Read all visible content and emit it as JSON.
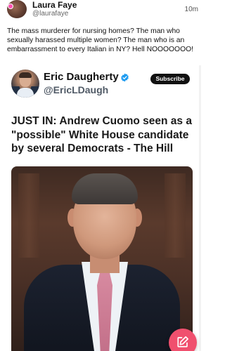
{
  "post": {
    "author_name": "Laura Faye",
    "author_handle": "@laurafaye",
    "timestamp": "10m",
    "text": "The mass murderer for nursing homes? The man who sexually harassed multiple women? The man who is an embarrassment to every Italian in NY? Hell NOOOOOOO!"
  },
  "embed": {
    "author_name": "Eric Daugherty",
    "author_handle": "@EricLDaugh",
    "subscribe_label": "Subscribe",
    "headline": "JUST IN: Andrew Cuomo seen as a \"possible\" White House candidate by several Democrats - The Hill"
  },
  "icons": {
    "verified": "verified-badge-icon",
    "compose": "compose-icon"
  },
  "colors": {
    "accent": "#f0506e",
    "verified": "#1d9bf0",
    "subscribe_bg": "#111111"
  }
}
